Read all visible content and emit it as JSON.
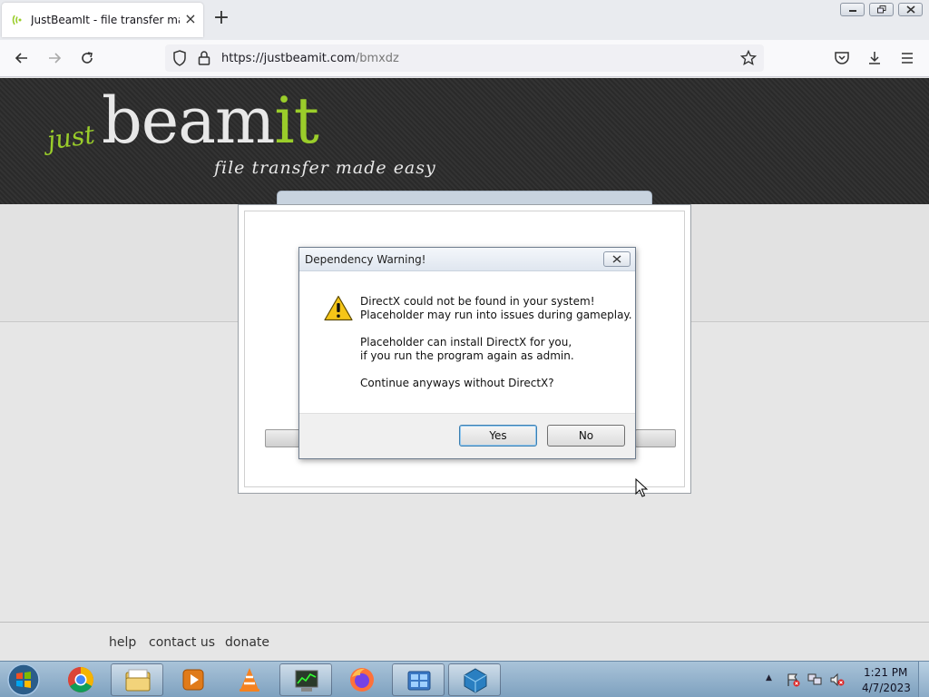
{
  "browser": {
    "tab_title": "JustBeamIt - file transfer made easy",
    "url_host": "https://justbeamit.com",
    "url_path": "/bmxdz"
  },
  "site": {
    "logo_just": "just",
    "logo_beam": "beam",
    "logo_it": "it",
    "tagline": "file transfer made easy",
    "footer_links": [
      "help",
      "contact us",
      "donate"
    ]
  },
  "dialog": {
    "title": "Dependency Warning!",
    "line1": "DirectX could not be found in your system!",
    "line2": "Placeholder may run into issues during gameplay.",
    "line3": "Placeholder can install DirectX for you,",
    "line4": "if you run the program again as admin.",
    "line5": "Continue anyways without DirectX?",
    "yes_label": "Yes",
    "no_label": "No"
  },
  "taskbar": {
    "apps": [
      "chrome-icon",
      "file-explorer-icon",
      "media-player-icon",
      "vlc-icon",
      "task-manager-icon",
      "firefox-icon",
      "control-panel-icon",
      "virtualbox-icon"
    ],
    "clock_time": "1:21 PM",
    "clock_date": "4/7/2023"
  },
  "colors": {
    "brand_green": "#9acd2a",
    "dialog_default_border": "#3c7fb1"
  }
}
